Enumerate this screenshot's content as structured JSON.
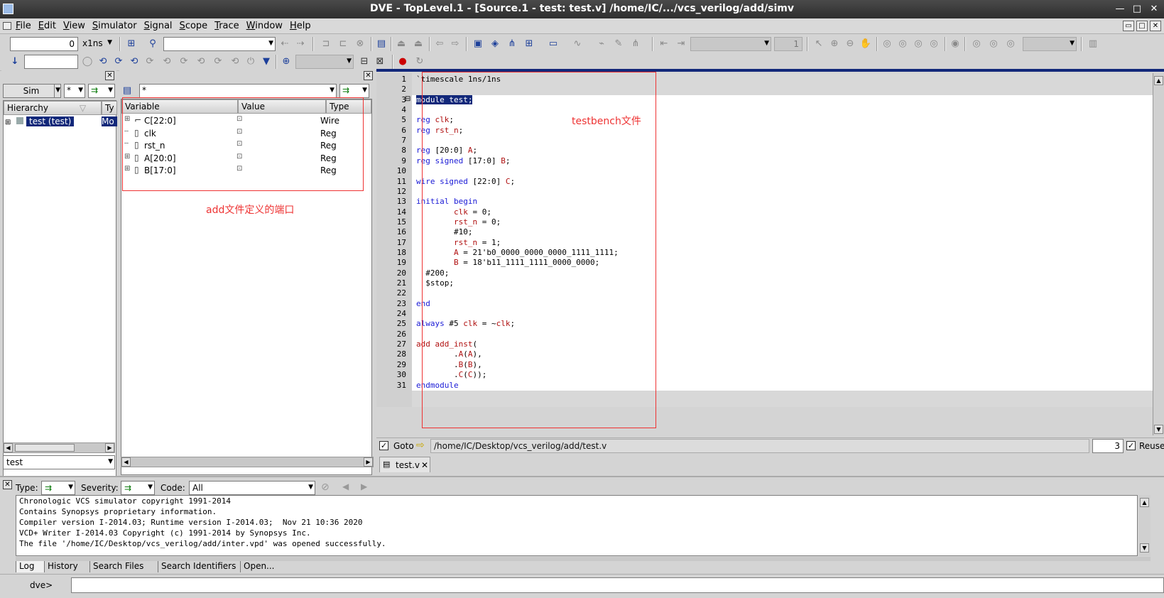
{
  "window": {
    "title": "DVE - TopLevel.1 - [Source.1 - test: test.v]  /home/IC/.../vcs_verilog/add/simv",
    "buttons": [
      "—",
      "□",
      "✕"
    ]
  },
  "menubar": {
    "items": [
      "File",
      "Edit",
      "View",
      "Simulator",
      "Signal",
      "Scope",
      "Trace",
      "Window",
      "Help"
    ],
    "mdi_buttons": [
      "▭",
      "□",
      "✕"
    ]
  },
  "toolbar1": {
    "time_value": "0",
    "time_unit": "x1ns",
    "page_field": "1"
  },
  "hierarchy_pane": {
    "sim_button": "Sim",
    "filter_value": "*",
    "columns": [
      "Hierarchy",
      "Ty"
    ],
    "rows": [
      {
        "name": "test (test)",
        "type": "Mo"
      }
    ],
    "bottom_field": "test"
  },
  "variable_pane": {
    "filter_value": "*",
    "columns": [
      "Variable",
      "Value",
      "Type"
    ],
    "rows": [
      {
        "name": "C[22:0]",
        "type": "Wire",
        "expandable": true,
        "kind": "bus"
      },
      {
        "name": "clk",
        "type": "Reg",
        "expandable": false,
        "kind": "reg"
      },
      {
        "name": "rst_n",
        "type": "Reg",
        "expandable": false,
        "kind": "reg"
      },
      {
        "name": "A[20:0]",
        "type": "Reg",
        "expandable": true,
        "kind": "reg"
      },
      {
        "name": "B[17:0]",
        "type": "Reg",
        "expandable": true,
        "kind": "reg"
      }
    ],
    "annotation": "add文件定义的端口"
  },
  "source_pane": {
    "annotation": "testbench文件",
    "lines": [
      [
        {
          "t": "`timescale 1ns/1ns"
        }
      ],
      [],
      [
        {
          "t": "module test;",
          "k": "sel"
        }
      ],
      [],
      [
        {
          "t": "reg ",
          "k": "kw"
        },
        {
          "t": "clk",
          "k": "id"
        },
        {
          "t": ";"
        }
      ],
      [
        {
          "t": "reg ",
          "k": "kw"
        },
        {
          "t": "rst_n",
          "k": "id"
        },
        {
          "t": ";"
        }
      ],
      [],
      [
        {
          "t": "reg ",
          "k": "kw"
        },
        {
          "t": "[20:0] "
        },
        {
          "t": "A",
          "k": "id"
        },
        {
          "t": ";"
        }
      ],
      [
        {
          "t": "reg signed ",
          "k": "kw"
        },
        {
          "t": "[17:0] "
        },
        {
          "t": "B",
          "k": "id"
        },
        {
          "t": ";"
        }
      ],
      [],
      [
        {
          "t": "wire signed ",
          "k": "kw"
        },
        {
          "t": "[22:0] "
        },
        {
          "t": "C",
          "k": "id"
        },
        {
          "t": ";"
        }
      ],
      [],
      [
        {
          "t": "initial begin",
          "k": "kw"
        }
      ],
      [
        {
          "t": "        "
        },
        {
          "t": "clk",
          "k": "id"
        },
        {
          "t": " = 0;"
        }
      ],
      [
        {
          "t": "        "
        },
        {
          "t": "rst_n",
          "k": "id"
        },
        {
          "t": " = 0;"
        }
      ],
      [
        {
          "t": "        #10;"
        }
      ],
      [
        {
          "t": "        "
        },
        {
          "t": "rst_n",
          "k": "id"
        },
        {
          "t": " = 1;"
        }
      ],
      [
        {
          "t": "        "
        },
        {
          "t": "A",
          "k": "id"
        },
        {
          "t": " = 21'b0_0000_0000_0000_1111_1111;"
        }
      ],
      [
        {
          "t": "        "
        },
        {
          "t": "B",
          "k": "id"
        },
        {
          "t": " = 18'b11_1111_1111_0000_0000;"
        }
      ],
      [
        {
          "t": "  #200;"
        }
      ],
      [
        {
          "t": "  $stop;"
        }
      ],
      [],
      [
        {
          "t": "end",
          "k": "kw"
        }
      ],
      [],
      [
        {
          "t": "always ",
          "k": "kw"
        },
        {
          "t": "#5 "
        },
        {
          "t": "clk",
          "k": "id"
        },
        {
          "t": " = ~"
        },
        {
          "t": "clk",
          "k": "id"
        },
        {
          "t": ";"
        }
      ],
      [],
      [
        {
          "t": "add ",
          "k": "id"
        },
        {
          "t": "add_inst",
          "k": "id"
        },
        {
          "t": "("
        }
      ],
      [
        {
          "t": "        ."
        },
        {
          "t": "A",
          "k": "id"
        },
        {
          "t": "("
        },
        {
          "t": "A",
          "k": "id"
        },
        {
          "t": "),"
        }
      ],
      [
        {
          "t": "        ."
        },
        {
          "t": "B",
          "k": "id"
        },
        {
          "t": "("
        },
        {
          "t": "B",
          "k": "id"
        },
        {
          "t": "),"
        }
      ],
      [
        {
          "t": "        ."
        },
        {
          "t": "C",
          "k": "id"
        },
        {
          "t": "("
        },
        {
          "t": "C",
          "k": "id"
        },
        {
          "t": "));"
        }
      ],
      [
        {
          "t": "endmodule",
          "k": "kw"
        }
      ]
    ],
    "goto_label": "Goto",
    "file_path": "/home/IC/Desktop/vcs_verilog/add/test.v",
    "line_field": "3",
    "reuse_label": "Reuse",
    "tab_label": "test.v"
  },
  "console": {
    "type_label": "Type:",
    "severity_label": "Severity:",
    "code_label": "Code:",
    "code_value": "All",
    "lines": [
      "Chronologic VCS simulator copyright 1991-2014",
      "Contains Synopsys proprietary information.",
      "Compiler version I-2014.03; Runtime version I-2014.03;  Nov 21 10:36 2020",
      "VCD+ Writer I-2014.03 Copyright (c) 1991-2014 by Synopsys Inc.",
      "The file '/home/IC/Desktop/vcs_verilog/add/inter.vpd' was opened successfully."
    ],
    "tabs": [
      "Log",
      "History",
      "Search Files",
      "Search Identifiers",
      "Open..."
    ],
    "prompt": "dve>"
  },
  "colors": {
    "annotation": "#e33333",
    "keyword": "#1a1ad6",
    "identifier": "#b01010",
    "selection": "#12287a"
  }
}
